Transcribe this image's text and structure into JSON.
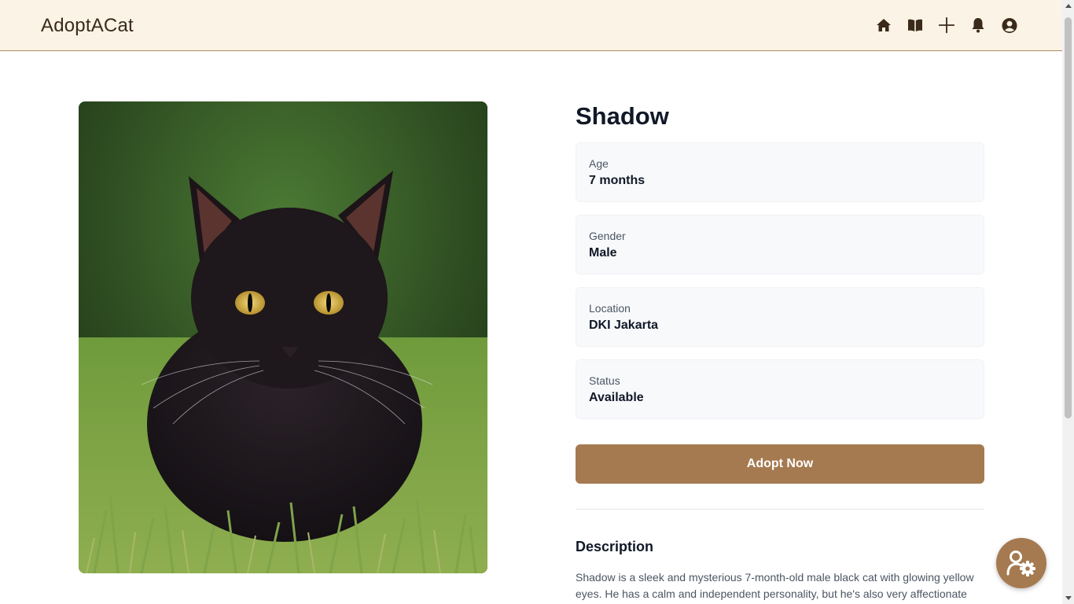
{
  "header": {
    "brand": "AdoptACat",
    "nav_icons": [
      "home-icon",
      "book-icon",
      "plus-icon",
      "bell-icon",
      "user-circle-icon"
    ]
  },
  "cat": {
    "name": "Shadow",
    "photo_alt": "black cat sitting in grass with yellow eyes",
    "details": [
      {
        "label": "Age",
        "value": "7 months"
      },
      {
        "label": "Gender",
        "value": "Male"
      },
      {
        "label": "Location",
        "value": "DKI Jakarta"
      },
      {
        "label": "Status",
        "value": "Available"
      }
    ],
    "adopt_label": "Adopt Now",
    "description_title": "Description",
    "description": "Shadow is a sleek and mysterious 7-month-old male black cat with glowing yellow eyes. He has a calm and independent personality, but he's also very affectionate"
  },
  "fab": {
    "icon": "user-settings-icon"
  },
  "colors": {
    "header_bg": "#faf3e6",
    "accent": "#a57a50",
    "card_bg": "#f8f9fb",
    "text_dark": "#111827"
  }
}
